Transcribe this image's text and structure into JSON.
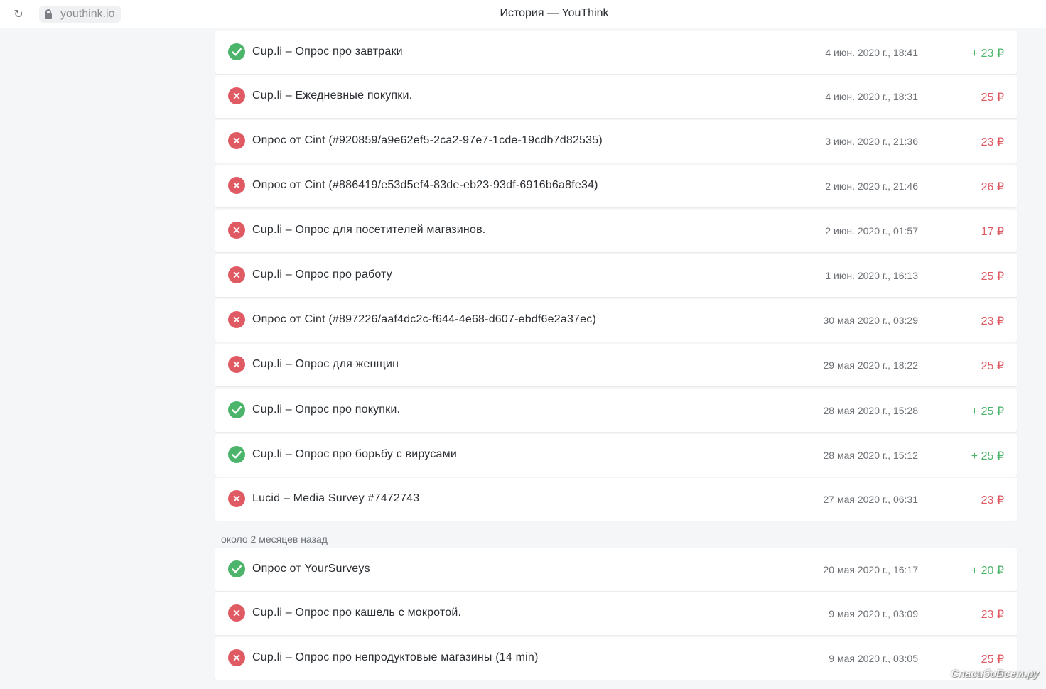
{
  "browser": {
    "url": "youthink.io",
    "window_title": "История — YouThink",
    "reload_icon": "reload-icon",
    "lock_icon": "lock-icon"
  },
  "colors": {
    "success": "#4cb56b",
    "fail": "#e05a63"
  },
  "history": {
    "rows": [
      {
        "status": "success",
        "title": "Cup.li – Опрос про завтраки",
        "date": "4 июн. 2020 г., 18:41",
        "amount": "+ 23 ₽"
      },
      {
        "status": "fail",
        "title": "Cup.li – Ежедневные покупки.",
        "date": "4 июн. 2020 г., 18:31",
        "amount": "25 ₽"
      },
      {
        "status": "fail",
        "title": "Опрос от Cint (#920859/a9e62ef5-2ca2-97e7-1cde-19cdb7d82535)",
        "date": "3 июн. 2020 г., 21:36",
        "amount": "23 ₽"
      },
      {
        "status": "fail",
        "title": "Опрос от Cint (#886419/e53d5ef4-83de-eb23-93df-6916b6a8fe34)",
        "date": "2 июн. 2020 г., 21:46",
        "amount": "26 ₽"
      },
      {
        "status": "fail",
        "title": "Cup.li – Опрос для посетителей магазинов.",
        "date": "2 июн. 2020 г., 01:57",
        "amount": "17 ₽"
      },
      {
        "status": "fail",
        "title": "Cup.li – Опрос про работу",
        "date": "1 июн. 2020 г., 16:13",
        "amount": "25 ₽"
      },
      {
        "status": "fail",
        "title": "Опрос от Cint (#897226/aaf4dc2c-f644-4e68-d607-ebdf6e2a37ec)",
        "date": "30 мая 2020 г., 03:29",
        "amount": "23 ₽"
      },
      {
        "status": "fail",
        "title": "Cup.li – Опрос для женщин",
        "date": "29 мая 2020 г., 18:22",
        "amount": "25 ₽"
      },
      {
        "status": "success",
        "title": "Cup.li – Опрос про покупки.",
        "date": "28 мая 2020 г., 15:28",
        "amount": "+ 25 ₽"
      },
      {
        "status": "success",
        "title": "Cup.li – Опрос про борьбу с вирусами",
        "date": "28 мая 2020 г., 15:12",
        "amount": "+ 25 ₽"
      },
      {
        "status": "fail",
        "title": "Lucid – Media Survey #7472743",
        "date": "27 мая 2020 г., 06:31",
        "amount": "23 ₽"
      }
    ],
    "group_label": "около 2 месяцев назад",
    "rows2": [
      {
        "status": "success",
        "title": "Опрос от YourSurveys",
        "date": "20 мая 2020 г., 16:17",
        "amount": "+ 20 ₽"
      },
      {
        "status": "fail",
        "title": "Cup.li – Опрос про кашель с мокротой.",
        "date": "9 мая 2020 г., 03:09",
        "amount": "23 ₽"
      },
      {
        "status": "fail",
        "title": "Cup.li – Опрос про непродуктовые магазины (14 min)",
        "date": "9 мая 2020 г., 03:05",
        "amount": "25 ₽"
      }
    ]
  },
  "watermark": "СпасибоВсем.ру"
}
